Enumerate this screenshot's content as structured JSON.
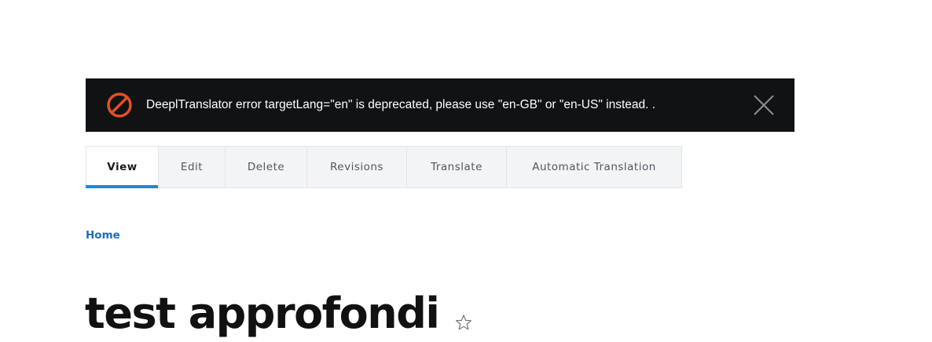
{
  "messages": {
    "error": {
      "text": "DeeplTranslator error targetLang=\"en\" is deprecated, please use \"en-GB\" or \"en-US\" instead. .",
      "icon": "error-prohibited-icon",
      "close_icon": "close-icon",
      "color": "#e34f24"
    }
  },
  "tabs": [
    {
      "label": "View",
      "active": true
    },
    {
      "label": "Edit",
      "active": false
    },
    {
      "label": "Delete",
      "active": false
    },
    {
      "label": "Revisions",
      "active": false
    },
    {
      "label": "Translate",
      "active": false
    },
    {
      "label": "Automatic Translation",
      "active": false
    }
  ],
  "breadcrumb": {
    "home_label": "Home"
  },
  "page": {
    "title": "test approfondi",
    "shortcut_icon": "star-icon"
  },
  "colors": {
    "accent": "#1e88d8",
    "link": "#1b6fb5",
    "error_bar_bg": "#111214"
  }
}
